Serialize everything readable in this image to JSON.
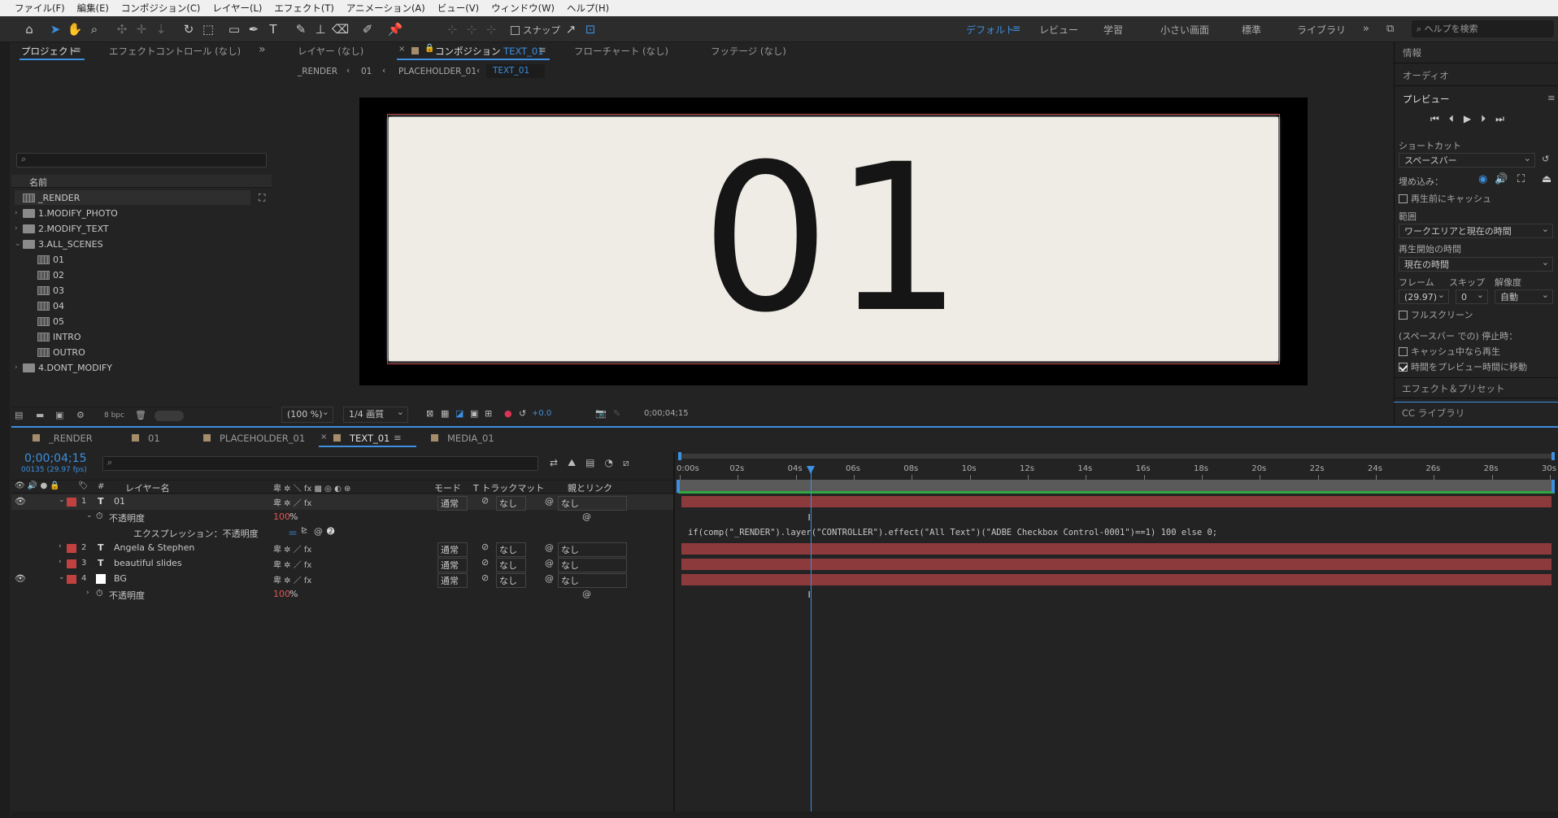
{
  "menu": [
    "ファイル(F)",
    "編集(E)",
    "コンポジション(C)",
    "レイヤー(L)",
    "エフェクト(T)",
    "アニメーション(A)",
    "ビュー(V)",
    "ウィンドウ(W)",
    "ヘルプ(H)"
  ],
  "toolbar": {
    "snap_label": "スナップ",
    "workspaces": [
      "デフォルト",
      "レビュー",
      "学習",
      "小さい画面",
      "標準",
      "ライブラリ"
    ],
    "help_placeholder": "ヘルプを検索"
  },
  "project_panel": {
    "tab_project": "プロジェクト",
    "tab_effects": "エフェクトコントロール (なし)",
    "col_name": "名前",
    "bpc": "8 bpc",
    "items": [
      {
        "name": "_RENDER",
        "kind": "comp",
        "indent": 0
      },
      {
        "name": "1.MODIFY_PHOTO",
        "kind": "folder",
        "indent": 0
      },
      {
        "name": "2.MODIFY_TEXT",
        "kind": "folder",
        "indent": 0
      },
      {
        "name": "3.ALL_SCENES",
        "kind": "folder-open",
        "indent": 0
      },
      {
        "name": "01",
        "kind": "comp",
        "indent": 1
      },
      {
        "name": "02",
        "kind": "comp",
        "indent": 1
      },
      {
        "name": "03",
        "kind": "comp",
        "indent": 1
      },
      {
        "name": "04",
        "kind": "comp",
        "indent": 1
      },
      {
        "name": "05",
        "kind": "comp",
        "indent": 1
      },
      {
        "name": "INTRO",
        "kind": "comp",
        "indent": 1
      },
      {
        "name": "OUTRO",
        "kind": "comp",
        "indent": 1
      },
      {
        "name": "4.DONT_MODIFY",
        "kind": "folder",
        "indent": 0
      }
    ]
  },
  "viewer": {
    "tab_layer": "レイヤー (なし)",
    "tab_comp_prefix": "コンポジション",
    "tab_comp_name": "TEXT_01",
    "tab_flow": "フローチャート (なし)",
    "tab_footage": "フッテージ (なし)",
    "breadcrumbs": [
      "_RENDER",
      "01",
      "PLACEHOLDER_01",
      "TEXT_01"
    ],
    "canvas_text": "01",
    "zoom": "(100 %)",
    "quality": "1/4 画質",
    "exposure": "+0.0",
    "timecode": "0;00;04;15"
  },
  "right_panel": {
    "info": "情報",
    "audio": "オーディオ",
    "preview": "プレビュー",
    "shortcut_label": "ショートカット",
    "shortcut_value": "スペースバー",
    "include_label": "埋め込み：",
    "cache_label": "再生前にキャッシュ",
    "range_label": "範囲",
    "range_value": "ワークエリアと現在の時間",
    "start_label": "再生開始の時間",
    "start_value": "現在の時間",
    "frame_label": "フレーム",
    "skip_label": "スキップ",
    "res_label": "解像度",
    "frame_value": "(29.97)",
    "skip_value": "0",
    "res_value": "自動",
    "fullscreen_label": "フルスクリーン",
    "stop_label": "(スペースバー での) 停止時：",
    "cache_play_label": "キャッシュ中なら再生",
    "move_time_label": "時間をプレビュー時間に移動",
    "effects_presets": "エフェクト＆プリセット",
    "cc_libraries": "CC ライブラリ"
  },
  "timeline": {
    "tabs": [
      "_RENDER",
      "01",
      "PLACEHOLDER_01",
      "TEXT_01",
      "MEDIA_01"
    ],
    "active_tab": "TEXT_01",
    "timecode": "0;00;04;15",
    "fps": "00135 (29.97 fps)",
    "col_layer_name": "レイヤー名",
    "col_mode": "モード",
    "col_trackmatte": "トラックマット",
    "col_parent": "親とリンク",
    "ruler": [
      "0:00s",
      "02s",
      "04s",
      "06s",
      "08s",
      "10s",
      "12s",
      "14s",
      "16s",
      "18s",
      "20s",
      "22s",
      "24s",
      "26s",
      "28s",
      "30s"
    ],
    "playhead_seconds": 4.5,
    "duration_seconds": 30,
    "layers": [
      {
        "num": "1",
        "type": "T",
        "name": "01",
        "mode": "通常",
        "matte": "なし",
        "parent": "なし",
        "expanded": true
      },
      {
        "num": "2",
        "type": "T",
        "name": "Angela & Stephen",
        "mode": "通常",
        "matte": "なし",
        "parent": "なし",
        "expanded": false
      },
      {
        "num": "3",
        "type": "T",
        "name": "beautiful slides",
        "mode": "通常",
        "matte": "なし",
        "parent": "なし",
        "expanded": false
      },
      {
        "num": "4",
        "type": "solid",
        "name": "BG",
        "mode": "通常",
        "matte": "なし",
        "parent": "なし",
        "expanded": true
      }
    ],
    "opacity_label": "不透明度",
    "opacity_value": "100",
    "percent": "%",
    "expression_label": "エクスプレッション：不透明度",
    "expression_code": "if(comp(\"_RENDER\").layer(\"CONTROLLER\").effect(\"All Text\")(\"ADBE Checkbox Control-0001\")==1) 100 else 0;"
  },
  "colors": {
    "accent": "#3d8fe0",
    "layer_label": "#c0413f",
    "bar": "#8c3a3c",
    "workarea": "#2fa840"
  }
}
